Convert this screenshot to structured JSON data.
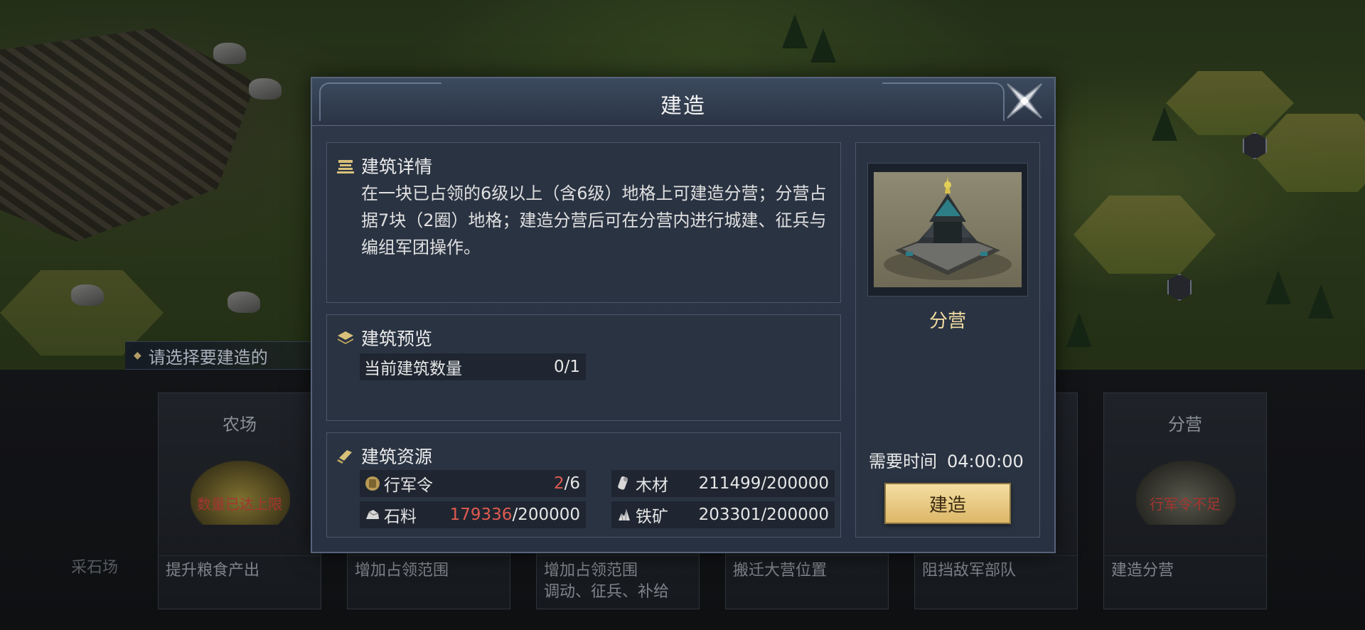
{
  "hint": "请选择要建造的",
  "cards": [
    {
      "title": "农场",
      "warn": "数量已达上限",
      "desc": "提升粮食产出"
    },
    {
      "title": "",
      "warn": "",
      "desc": "增加占领范围"
    },
    {
      "title": "",
      "warn": "",
      "desc": "增加占领范围\n调动、征兵、补给"
    },
    {
      "title": "",
      "warn": "",
      "desc": "搬迁大营位置"
    },
    {
      "title": "",
      "warn": "",
      "desc": "阻挡敌军部队"
    },
    {
      "title": "分营",
      "warn": "行军令不足",
      "desc": "建造分营"
    }
  ],
  "left_stub": "采石场",
  "modal": {
    "title": "建造",
    "detail": {
      "heading": "建筑详情",
      "text": "在一块已占领的6级以上（含6级）地格上可建造分营；分营占据7块（2圈）地格；建造分营后可在分营内进行城建、征兵与编组军团操作。"
    },
    "preview": {
      "heading": "建筑预览",
      "count_label": "当前建筑数量",
      "count_value": "0/1"
    },
    "resources": {
      "heading": "建筑资源",
      "items": [
        {
          "icon": "march-order-icon",
          "label": "行军令",
          "have": "2",
          "need": "/6",
          "short": true
        },
        {
          "icon": "wood-icon",
          "label": "木材",
          "have": "211499",
          "need": "/200000",
          "short": false
        },
        {
          "icon": "stone-icon",
          "label": "石料",
          "have": "179336",
          "need": "/200000",
          "short": true
        },
        {
          "icon": "iron-icon",
          "label": "铁矿",
          "have": "203301",
          "need": "/200000",
          "short": false
        }
      ]
    },
    "building_name": "分营",
    "time_label": "需要时间",
    "time_value": "04:00:00",
    "build_button": "建造"
  },
  "colors": {
    "accent_gold": "#f1dca0",
    "warning_red": "#e05a50",
    "button_gold": "#dcb767"
  }
}
